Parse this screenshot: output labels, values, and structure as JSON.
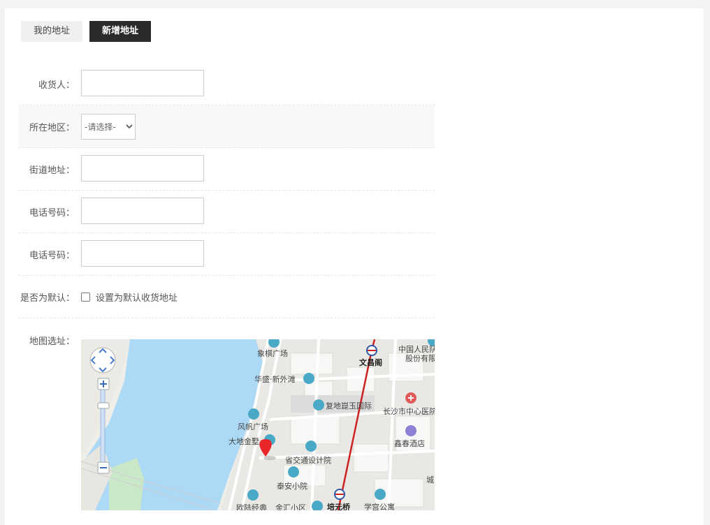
{
  "tabs": {
    "my_address": "我的地址",
    "new_address": "新增地址"
  },
  "form": {
    "recipient_label": "收货人：",
    "region_label": "所在地区：",
    "region_select": "-请选择-",
    "street_label": "街道地址：",
    "phone1_label": "电话号码：",
    "phone2_label": "电话号码：",
    "default_label": "是否为默认：",
    "default_checkbox_label": "设置为默认收货地址",
    "map_label": "地图选址："
  },
  "map": {
    "places": {
      "xiangqi": "象棋广场",
      "wenchangge": "文昌阁",
      "renmin1": "中国人民队",
      "renmin2": "股份有限",
      "huasheng": "华盛·新外滩",
      "fudi": "复地崑玉国际",
      "changsha": "长沙市中心医院",
      "fengfan": "风帆广场",
      "dadi": "大地金墅",
      "xinchun": "鑫春酒店",
      "shengjiao": "省交通设计院",
      "cheng": "城",
      "taian": "泰安小院",
      "oulu": "欧陆经典",
      "jinhui": "金汇小区",
      "peiyuan": "培元桥",
      "xuegong": "学宫公寓"
    }
  }
}
